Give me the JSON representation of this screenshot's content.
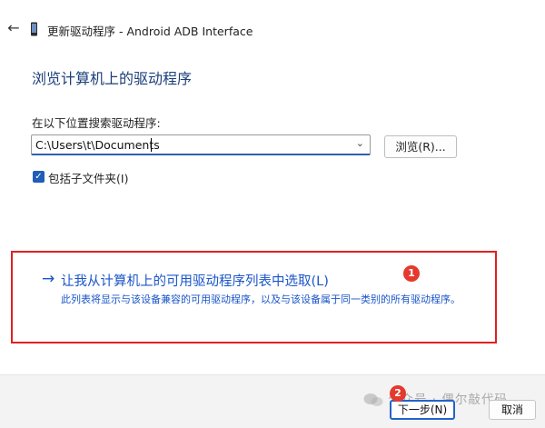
{
  "window": {
    "title": "更新驱动程序 - Android ADB Interface",
    "back_icon": "back-arrow-icon",
    "device_icon": "device-icon"
  },
  "main": {
    "heading": "浏览计算机上的驱动程序",
    "search_label": "在以下位置搜索驱动程序:",
    "path_value": "C:\\Users\\t\\Documents",
    "browse_label": "浏览(R)...",
    "include_subfolders_label": "包括子文件夹(I)",
    "include_subfolders_checked": true
  },
  "pick_option": {
    "arrow": "→",
    "title": "让我从计算机上的可用驱动程序列表中选取(L)",
    "description": "此列表将显示与该设备兼容的可用驱动程序，以及与该设备属于同一类别的所有驱动程序。"
  },
  "annotations": {
    "badge_1": "1",
    "badge_2": "2",
    "badge_color": "#e43a2e",
    "box_color": "#e02020"
  },
  "footer": {
    "next_label": "下一步(N)",
    "cancel_label": "取消"
  },
  "watermark": {
    "text": "公众号 · 偶尔敲代码"
  },
  "colors": {
    "link": "#1a55c8",
    "heading": "#1c3f7a",
    "accent": "#2463c9"
  }
}
